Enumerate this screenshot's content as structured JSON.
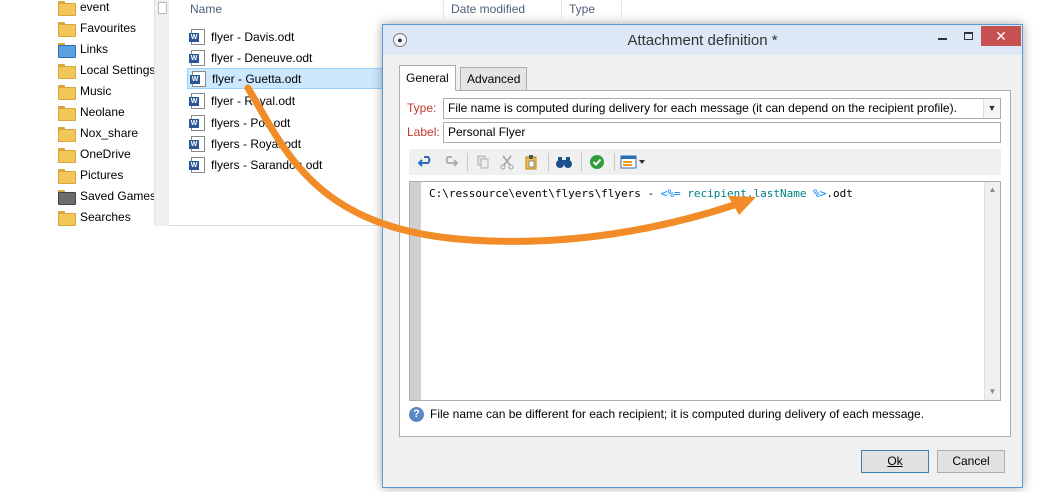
{
  "explorer": {
    "nav_items": [
      {
        "label": "event",
        "icon": "folder-icon"
      },
      {
        "label": "Favourites",
        "icon": "favourites-folder-icon"
      },
      {
        "label": "Links",
        "icon": "links-folder-icon"
      },
      {
        "label": "Local Settings",
        "icon": "folder-icon"
      },
      {
        "label": "Music",
        "icon": "folder-icon"
      },
      {
        "label": "Neolane",
        "icon": "folder-icon"
      },
      {
        "label": "Nox_share",
        "icon": "folder-icon"
      },
      {
        "label": "OneDrive",
        "icon": "folder-icon"
      },
      {
        "label": "Pictures",
        "icon": "folder-icon"
      },
      {
        "label": "Saved Games",
        "icon": "saved-games-folder-icon"
      },
      {
        "label": "Searches",
        "icon": "searches-folder-icon"
      }
    ],
    "columns": {
      "name": "Name",
      "date_modified": "Date modified",
      "type": "Type"
    },
    "files": [
      {
        "name": "flyer - Davis.odt",
        "selected": false
      },
      {
        "name": "flyer - Deneuve.odt",
        "selected": false
      },
      {
        "name": "flyer - Guetta.odt",
        "selected": true
      },
      {
        "name": "flyer - Royal.odt",
        "selected": false
      },
      {
        "name": "flyers - Poli.odt",
        "selected": false
      },
      {
        "name": "flyers - Royal.odt",
        "selected": false
      },
      {
        "name": "flyers - Sarandon.odt",
        "selected": false
      }
    ]
  },
  "dialog": {
    "title": "Attachment definition *",
    "window_buttons": {
      "close": "✕"
    },
    "tabs": [
      {
        "label": "General",
        "active": true
      },
      {
        "label": "Advanced",
        "active": false
      }
    ],
    "type_label": "Type:",
    "type_value": "File name is computed during delivery for each message (it can depend on the recipient profile).",
    "label_label": "Label:",
    "label_value": "Personal Flyer",
    "toolbar_icons": [
      "undo-icon",
      "redo-icon",
      "copy-icon",
      "cut-icon",
      "paste-icon",
      "find-icon",
      "validate-icon",
      "insert-icon"
    ],
    "code": {
      "prefix": "C:\\ressource\\event\\flyers\\flyers - ",
      "open_tag": "<%=",
      "expression": " recipient.lastName ",
      "close_tag": "%>",
      "suffix": ".odt"
    },
    "info_text": "File name can be different for each recipient; it is computed during delivery of each message.",
    "ok_label": "Ok",
    "cancel_label": "Cancel"
  },
  "colors": {
    "arrow": "#f28c28",
    "accent": "#5b9bd5",
    "field_label": "#c0392b",
    "close_button": "#c75050"
  }
}
